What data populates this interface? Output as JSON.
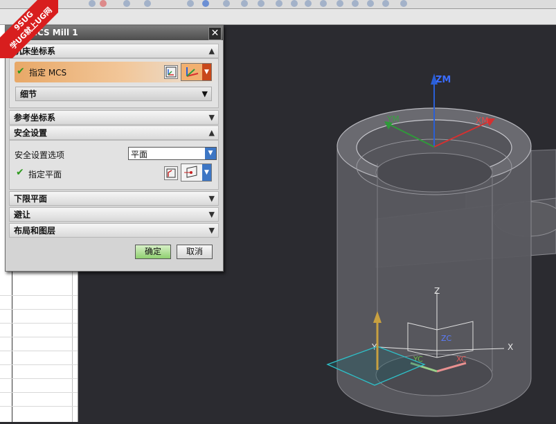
{
  "watermark": {
    "line1": "9SUG",
    "line2": "学UG就上UG网"
  },
  "dialog": {
    "title": "MCS Mill 1",
    "close_label": "✕",
    "sections": {
      "machine_csys": {
        "label": "机床坐标系",
        "expanded": true
      },
      "specify_mcs": {
        "label": "指定 MCS"
      },
      "details": {
        "label": "细节"
      },
      "reference_csys": {
        "label": "参考坐标系"
      },
      "clearance": {
        "label": "安全设置",
        "expanded": true
      },
      "clearance_option_label": "安全设置选项",
      "clearance_option_value": "平面",
      "specify_plane": {
        "label": "指定平面"
      },
      "lower_limit_plane": {
        "label": "下限平面"
      },
      "avoidance": {
        "label": "避让"
      },
      "layout_layers": {
        "label": "布局和图层"
      }
    },
    "ok_label": "确定",
    "cancel_label": "取消"
  },
  "viewport_labels": {
    "zm": "ZM",
    "xm": "XM",
    "ym": "YM",
    "z": "Z",
    "x": "X",
    "y": "Y",
    "zc": "ZC",
    "xc": "XC",
    "yc": "YC"
  },
  "colors": {
    "accent_orange": "#e8a867",
    "check_green": "#2e9a1e",
    "dropdown_blue": "#3d76c4",
    "ok_green": "#8fd070"
  }
}
